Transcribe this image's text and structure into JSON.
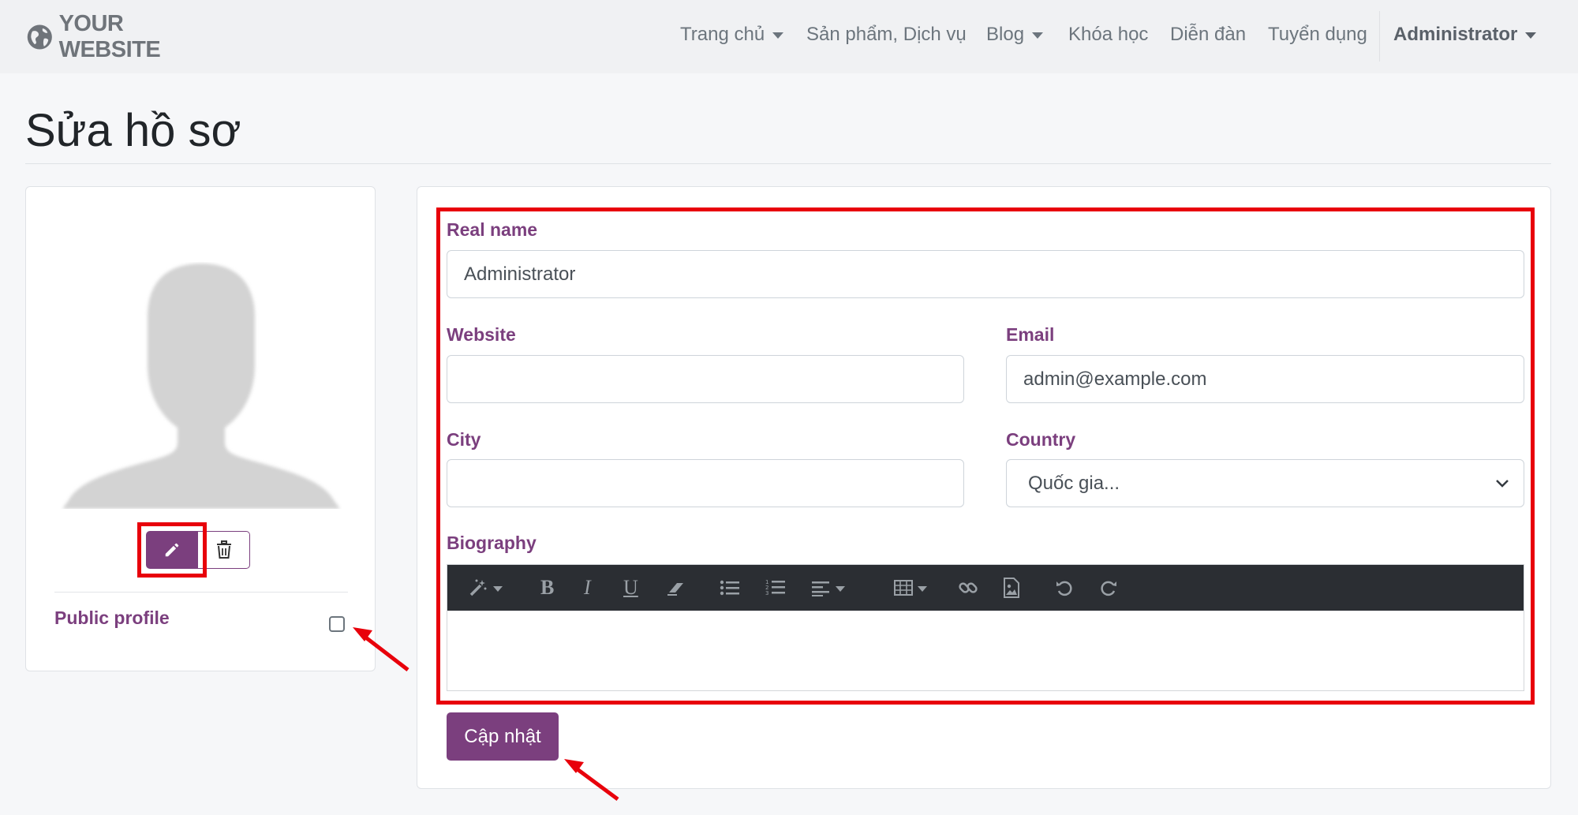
{
  "navbar": {
    "brand": "YOUR WEBSITE",
    "items": [
      {
        "label": "Trang chủ",
        "dropdown": true
      },
      {
        "label": "Sản phẩm, Dịch vụ",
        "dropdown": false
      },
      {
        "label": "Blog",
        "dropdown": true
      },
      {
        "label": "Khóa học",
        "dropdown": false
      },
      {
        "label": "Diễn đàn",
        "dropdown": false
      },
      {
        "label": "Tuyển dụng",
        "dropdown": false
      }
    ],
    "user": {
      "label": "Administrator",
      "dropdown": true
    }
  },
  "page": {
    "title": "Sửa hồ sơ"
  },
  "profile": {
    "public_label": "Public profile",
    "public_checked": false
  },
  "form": {
    "real_name": {
      "label": "Real name",
      "value": "Administrator"
    },
    "website": {
      "label": "Website",
      "value": ""
    },
    "email": {
      "label": "Email",
      "value": "admin@example.com"
    },
    "city": {
      "label": "City",
      "value": ""
    },
    "country": {
      "label": "Country",
      "selected": "Quốc gia..."
    },
    "biography": {
      "label": "Biography",
      "value": ""
    },
    "toolbar": [
      "magic-icon",
      "bold-icon",
      "italic-icon",
      "underline-icon",
      "eraser-icon",
      "unordered-list-icon",
      "ordered-list-icon",
      "align-icon",
      "table-icon",
      "link-icon",
      "image-icon",
      "undo-icon",
      "redo-icon"
    ],
    "toolbar_text": {
      "bold": "B",
      "italic": "I",
      "underline": "U"
    },
    "submit_label": "Cập nhật"
  },
  "colors": {
    "accent": "#7b3f7e",
    "annotation": "#e8000b",
    "toolbar_bg": "#2b2e33"
  }
}
